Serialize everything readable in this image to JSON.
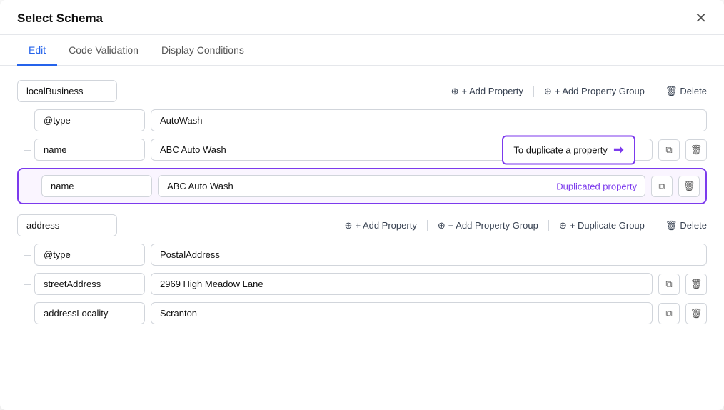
{
  "modal": {
    "title": "Select Schema",
    "close_label": "✕"
  },
  "tabs": [
    {
      "id": "edit",
      "label": "Edit",
      "active": true
    },
    {
      "id": "code-validation",
      "label": "Code Validation",
      "active": false
    },
    {
      "id": "display-conditions",
      "label": "Display Conditions",
      "active": false
    }
  ],
  "top_group": {
    "name": "localBusiness",
    "actions": {
      "add_property": "+ Add Property",
      "add_property_group": "+ Add Property Group",
      "delete": "Delete"
    },
    "properties": [
      {
        "key": "@type",
        "value": "AutoWash",
        "show_icons": false,
        "highlight": false
      },
      {
        "key": "name",
        "value": "ABC Auto Wash",
        "show_icons": true,
        "highlight": false,
        "callout": "To duplicate a property"
      },
      {
        "key": "name",
        "value": "ABC Auto Wash",
        "show_icons": true,
        "highlight": true,
        "dup_label": "Duplicated property"
      }
    ]
  },
  "sub_group": {
    "name": "address",
    "actions": {
      "add_property": "+ Add Property",
      "add_property_group": "+ Add Property Group",
      "duplicate_group": "+ Duplicate Group",
      "delete": "Delete"
    },
    "properties": [
      {
        "key": "@type",
        "value": "PostalAddress",
        "show_icons": false
      },
      {
        "key": "streetAddress",
        "value": "2969 High Meadow Lane",
        "show_icons": true
      },
      {
        "key": "addressLocality",
        "value": "Scranton",
        "show_icons": true
      }
    ]
  },
  "icons": {
    "copy": "⧉",
    "trash": "🗑",
    "arrow_right": "➜"
  }
}
